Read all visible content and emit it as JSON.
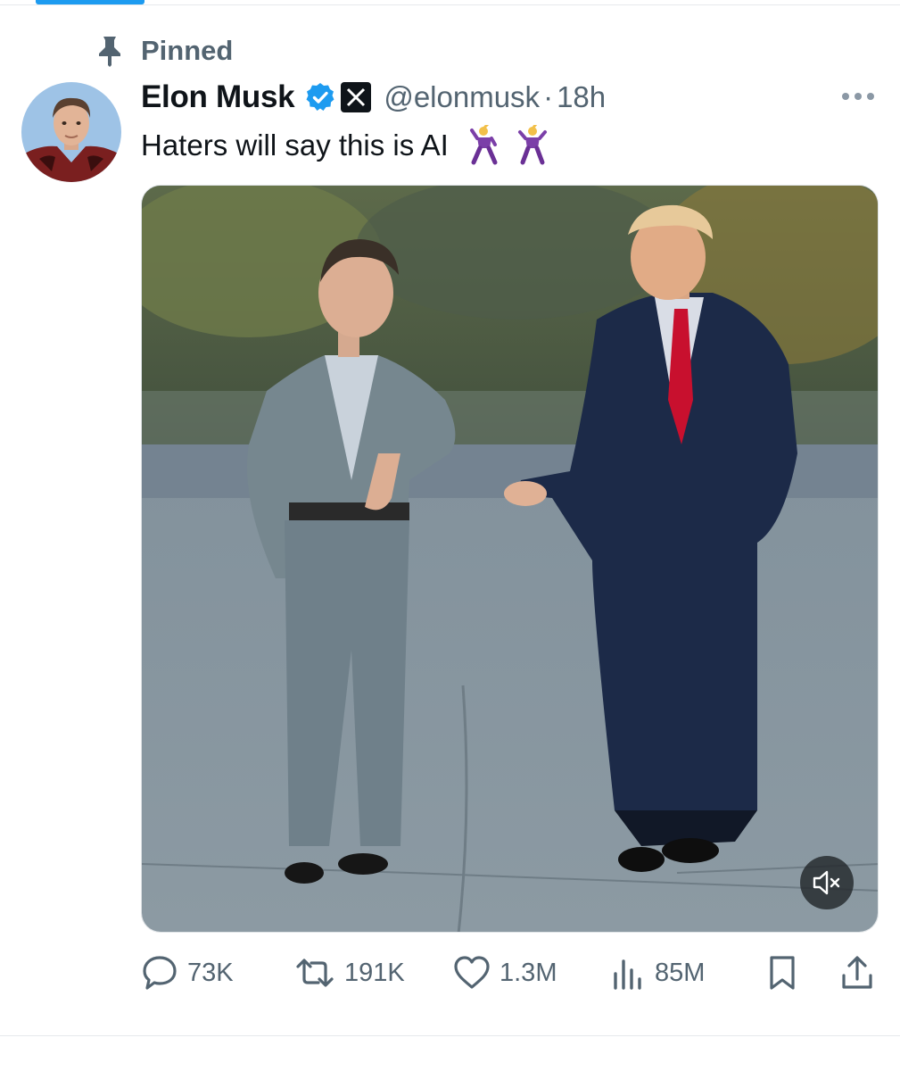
{
  "pinned": {
    "label": "Pinned",
    "icon": "pin-icon"
  },
  "author": {
    "display_name": "Elon Musk",
    "handle": "@elonmusk",
    "separator": "·",
    "timestamp": "18h",
    "verified_badge": "verified-icon",
    "affiliate_badge": "x-logo-icon"
  },
  "tweet": {
    "text": "Haters will say this is AI",
    "emoji": [
      "dancer-emoji",
      "dancer-emoji"
    ],
    "media": {
      "type": "video",
      "muted": true
    }
  },
  "actions": {
    "replies": "73K",
    "reposts": "191K",
    "likes": "1.3M",
    "views": "85M"
  },
  "colors": {
    "accent": "#1d9bf0",
    "text_primary": "#0f1419",
    "text_secondary": "#536471"
  }
}
